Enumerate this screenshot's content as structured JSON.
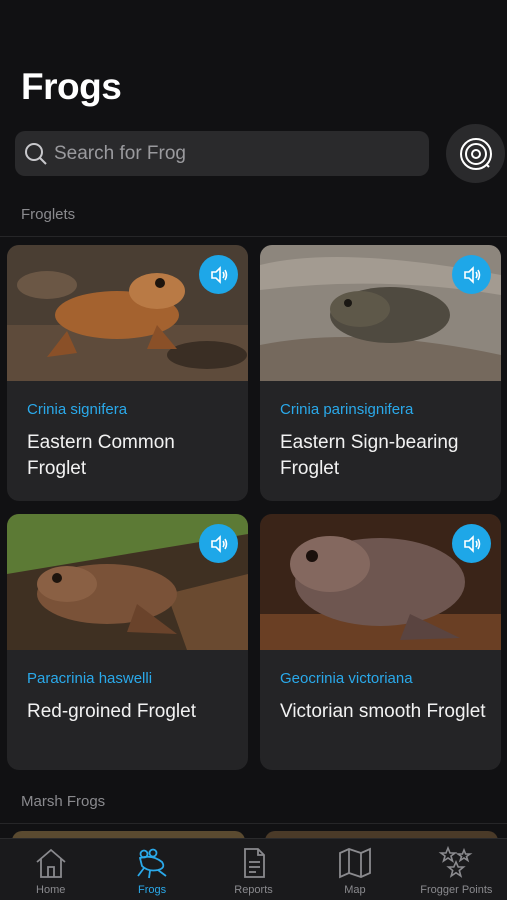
{
  "header": {
    "title": "Frogs"
  },
  "search": {
    "placeholder": "Search for Frog",
    "icon": "search-icon"
  },
  "scan_button": {
    "icon": "frog-call-scan-icon"
  },
  "sections": [
    {
      "heading": "Froglets",
      "cards": [
        {
          "scientific": "Crinia signifera",
          "common": "Eastern Common Froglet",
          "photo_colors": [
            "#7a4a2c",
            "#b56a3a",
            "#54463a"
          ]
        },
        {
          "scientific": "Crinia parinsignifera",
          "common": "Eastern Sign-bearing Froglet",
          "photo_colors": [
            "#8c8680",
            "#5f574c",
            "#a59d93"
          ]
        },
        {
          "scientific": "Paracrinia haswelli",
          "common": "Red-groined Froglet",
          "photo_colors": [
            "#6e4a32",
            "#4d6b2f",
            "#8a5b3c"
          ]
        },
        {
          "scientific": "Geocrinia victoriana",
          "common": "Victorian smooth Froglet",
          "photo_colors": [
            "#5a423c",
            "#8a6e66",
            "#3e2a20"
          ]
        }
      ]
    },
    {
      "heading": "Marsh Frogs"
    }
  ],
  "tabs": [
    {
      "label": "Home",
      "icon": "home-icon",
      "active": false
    },
    {
      "label": "Frogs",
      "icon": "frog-icon",
      "active": true
    },
    {
      "label": "Reports",
      "icon": "document-icon",
      "active": false
    },
    {
      "label": "Map",
      "icon": "map-icon",
      "active": false
    },
    {
      "label": "Frogger Points",
      "icon": "stars-icon",
      "active": false
    }
  ],
  "colors": {
    "accent": "#2aa9ea",
    "sound_button": "#1ea7e8",
    "background": "#111113",
    "card": "#242426"
  }
}
